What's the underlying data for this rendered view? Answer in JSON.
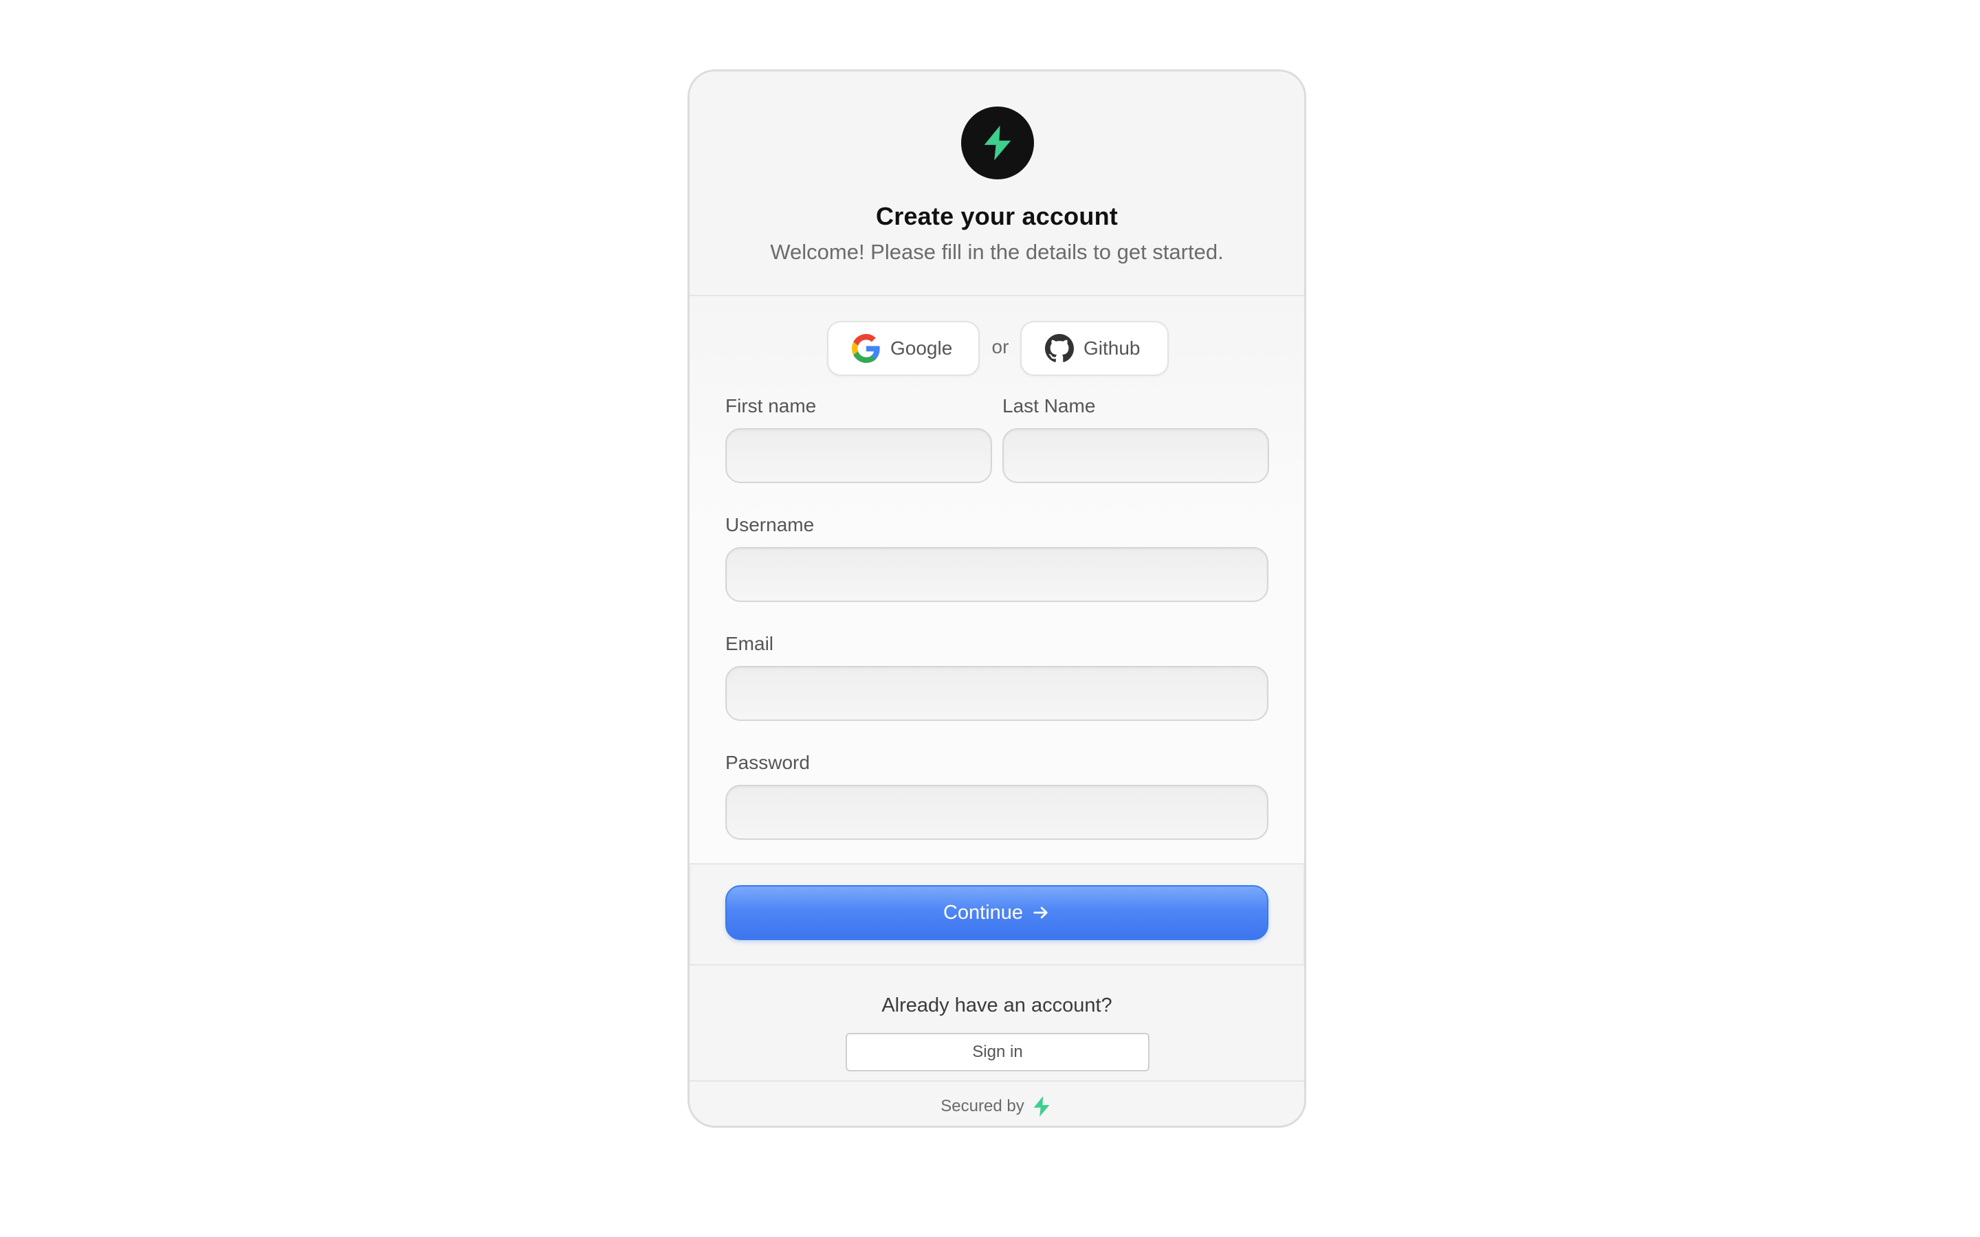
{
  "header": {
    "logo_icon": "bolt-icon",
    "title": "Create your account",
    "subtitle": "Welcome! Please fill in the details to get started."
  },
  "social": {
    "google_label": "Google",
    "google_icon": "google-icon",
    "separator": "or",
    "github_label": "Github",
    "github_icon": "github-icon"
  },
  "form": {
    "first_name": {
      "label": "First name",
      "value": "",
      "placeholder": ""
    },
    "last_name": {
      "label": "Last Name",
      "value": "",
      "placeholder": ""
    },
    "username": {
      "label": "Username",
      "value": "",
      "placeholder": ""
    },
    "email": {
      "label": "Email",
      "value": "",
      "placeholder": ""
    },
    "password": {
      "label": "Password",
      "value": "",
      "placeholder": ""
    }
  },
  "actions": {
    "continue_label": "Continue",
    "continue_icon": "arrow-right-icon"
  },
  "footer": {
    "prompt": "Already have an account?",
    "signin_label": "Sign in",
    "secured_by": "Secured by",
    "secured_icon": "bolt-icon"
  },
  "colors": {
    "accent_blue": "#4f86f5",
    "brand_green": "#3ecf8e",
    "logo_bg": "#111111",
    "card_bg": "#f5f5f5"
  }
}
